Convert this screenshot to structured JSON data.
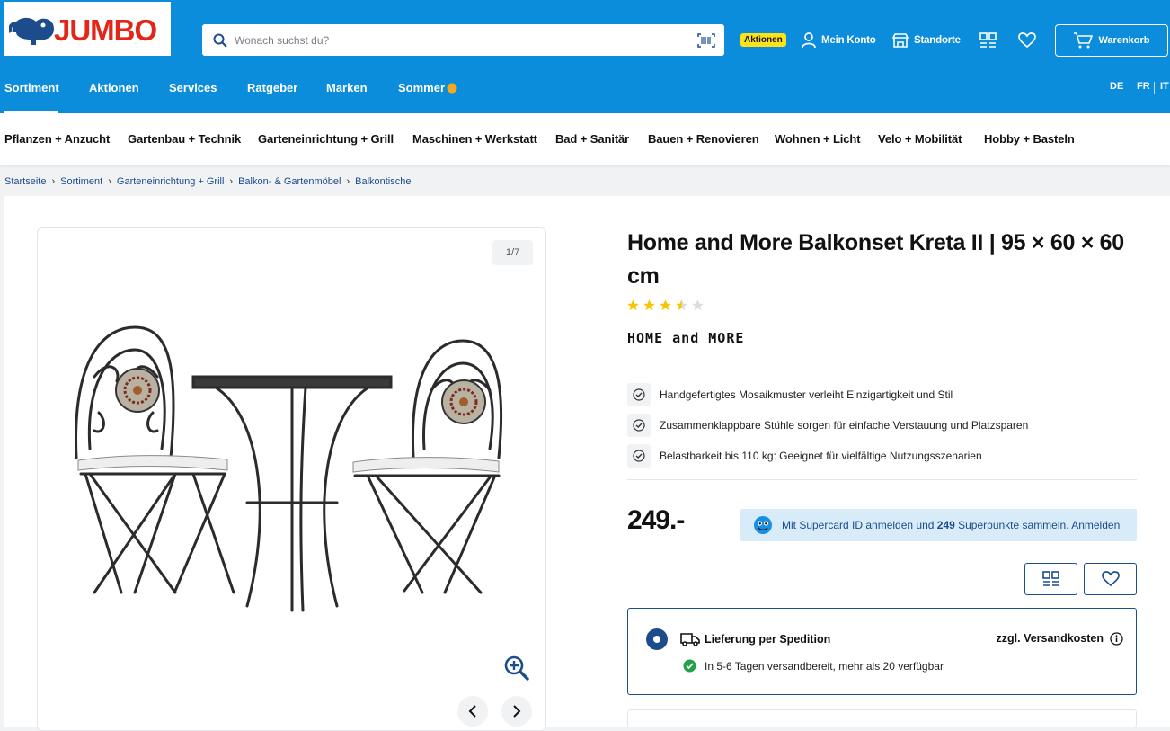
{
  "header": {
    "logo": "JUMBO",
    "search_placeholder": "Wonach suchst du?",
    "aktionen_badge": "Aktionen",
    "account": "Mein Konto",
    "stores": "Standorte",
    "cart": "Warenkorb"
  },
  "mainnav": [
    "Sortiment",
    "Aktionen",
    "Services",
    "Ratgeber",
    "Marken",
    "Sommer"
  ],
  "languages": [
    "DE",
    "FR",
    "IT"
  ],
  "subnav": [
    "Pflanzen + Anzucht",
    "Gartenbau + Technik",
    "Garteneinrichtung + Grill",
    "Maschinen + Werkstatt",
    "Bad + Sanitär",
    "Bauen + Renovieren",
    "Wohnen + Licht",
    "Velo + Mobilität",
    "Hobby + Basteln"
  ],
  "breadcrumb": [
    "Startseite",
    "Sortiment",
    "Garteneinrichtung + Grill",
    "Balkon- & Gartenmöbel",
    "Balkontische"
  ],
  "gallery": {
    "counter": "1/7"
  },
  "product": {
    "title": "Home and More Balkonset Kreta II | 95 × 60 × 60 cm",
    "rating": 3.5,
    "rating_max": 5,
    "brand": "HOME and MORE",
    "features": [
      "Handgefertigtes Mosaikmuster verleiht Einzigartigkeit und Stil",
      "Zusammenklappbare Stühle sorgen für einfache Verstauung und Platzsparen",
      "Belastbarkeit bis 110 kg: Geeignet für vielfältige Nutzungsszenarien"
    ],
    "price": "249.-",
    "supercard_prefix": "Mit Supercard ID anmelden und ",
    "supercard_points": "249",
    "supercard_suffix": " Superpunkte sammeln. ",
    "supercard_link": "Anmelden"
  },
  "delivery": {
    "title": "Lieferung per Spedition",
    "cost": "zzgl. Versandkosten",
    "availability": "In 5-6 Tagen versandbereit, mehr als 20 verfügbar"
  },
  "colors": {
    "brand_blue": "#0b8ddb",
    "dark_blue": "#1c4c8c",
    "jumbo_red": "#e2261a",
    "badge_yellow": "#fde21a",
    "star": "#f7c600"
  }
}
